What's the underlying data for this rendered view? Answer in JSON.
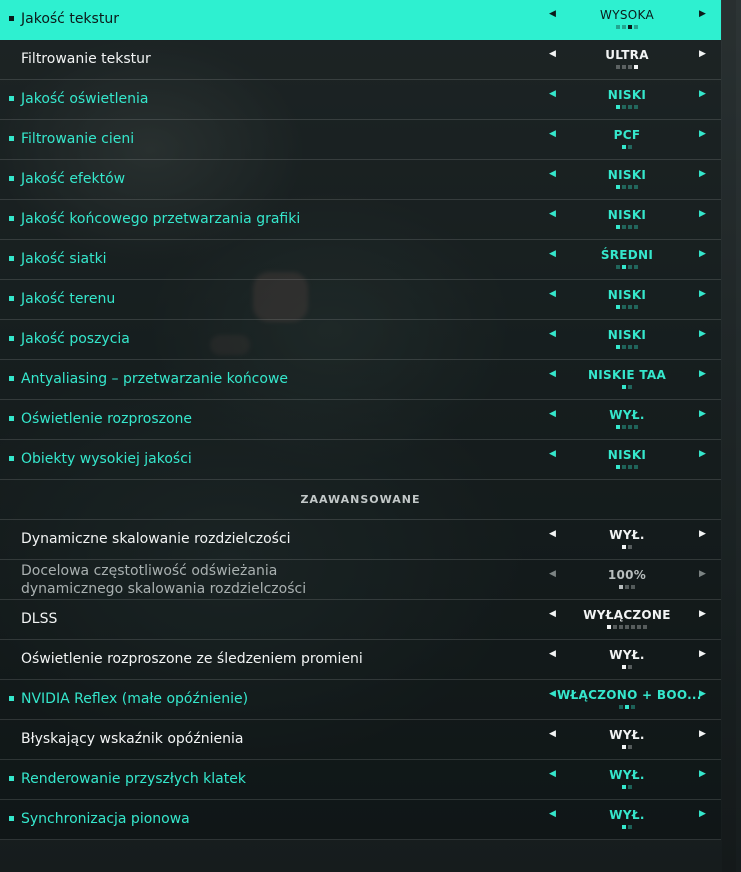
{
  "colors": {
    "accent": "#35e7cc",
    "highlight_row": "#2ef0d0",
    "text_white": "#f2f4f4"
  },
  "graphics_settings": [
    {
      "label": "Jakość tekstur",
      "value": "WYSOKA",
      "style": "active",
      "bullet": true,
      "dots_total": 4,
      "dot_on": 3
    },
    {
      "label": "Filtrowanie tekstur",
      "value": "ULTRA",
      "style": "white",
      "bullet": false,
      "dots_total": 4,
      "dot_on": 4
    },
    {
      "label": "Jakość oświetlenia",
      "value": "NISKI",
      "style": "accent",
      "bullet": true,
      "dots_total": 4,
      "dot_on": 1
    },
    {
      "label": "Filtrowanie cieni",
      "value": "PCF",
      "style": "accent",
      "bullet": true,
      "dots_total": 2,
      "dot_on": 1
    },
    {
      "label": "Jakość efektów",
      "value": "NISKI",
      "style": "accent",
      "bullet": true,
      "dots_total": 4,
      "dot_on": 1
    },
    {
      "label": "Jakość końcowego przetwarzania grafiki",
      "value": "NISKI",
      "style": "accent",
      "bullet": true,
      "dots_total": 4,
      "dot_on": 1
    },
    {
      "label": "Jakość siatki",
      "value": "ŚREDNI",
      "style": "accent",
      "bullet": true,
      "dots_total": 4,
      "dot_on": 2
    },
    {
      "label": "Jakość terenu",
      "value": "NISKI",
      "style": "accent",
      "bullet": true,
      "dots_total": 4,
      "dot_on": 1
    },
    {
      "label": "Jakość poszycia",
      "value": "NISKI",
      "style": "accent",
      "bullet": true,
      "dots_total": 4,
      "dot_on": 1
    },
    {
      "label": "Antyaliasing – przetwarzanie końcowe",
      "value": "NISKIE TAA",
      "style": "accent",
      "bullet": true,
      "dots_total": 2,
      "dot_on": 1
    },
    {
      "label": "Oświetlenie rozproszone",
      "value": "WYŁ.",
      "style": "accent",
      "bullet": true,
      "dots_total": 4,
      "dot_on": 1
    },
    {
      "label": "Obiekty wysokiej jakości",
      "value": "NISKI",
      "style": "accent",
      "bullet": true,
      "dots_total": 4,
      "dot_on": 1
    }
  ],
  "advanced_header": "ZAAWANSOWANE",
  "advanced_settings": [
    {
      "label": "Dynamiczne skalowanie rozdzielczości",
      "value": "WYŁ.",
      "style": "white",
      "bullet": false,
      "dots_total": 2,
      "dot_on": 1
    },
    {
      "label": "Docelowa częstotliwość odświeżania dynamicznego skalowania rozdzielczości",
      "label_lines": [
        "Docelowa częstotliwość odświeżania",
        "dynamicznego skalowania rozdzielczości"
      ],
      "value": "100%",
      "style": "dim",
      "bullet": false,
      "dots_total": 3,
      "dot_on": 1
    },
    {
      "label": "DLSS",
      "value": "WYŁĄCZONE",
      "style": "white",
      "bullet": false,
      "dots_total": 7,
      "dot_on": 1
    },
    {
      "label": "Oświetlenie rozproszone ze śledzeniem promieni",
      "value": "WYŁ.",
      "style": "white",
      "bullet": false,
      "dots_total": 2,
      "dot_on": 1
    },
    {
      "label": "NVIDIA Reflex (małe opóźnienie)",
      "value": "WŁĄCZONO + BOO...",
      "style": "accent",
      "bullet": true,
      "dots_total": 3,
      "dot_on": 2
    },
    {
      "label": "Błyskający wskaźnik opóźnienia",
      "value": "WYŁ.",
      "style": "white",
      "bullet": false,
      "dots_total": 2,
      "dot_on": 1
    },
    {
      "label": "Renderowanie przyszłych klatek",
      "value": "WYŁ.",
      "style": "accent",
      "bullet": true,
      "dots_total": 2,
      "dot_on": 1
    },
    {
      "label": "Synchronizacja pionowa",
      "value": "WYŁ.",
      "style": "accent",
      "bullet": true,
      "dots_total": 2,
      "dot_on": 1
    }
  ],
  "icons": {
    "left": "◀",
    "right": "▶"
  }
}
